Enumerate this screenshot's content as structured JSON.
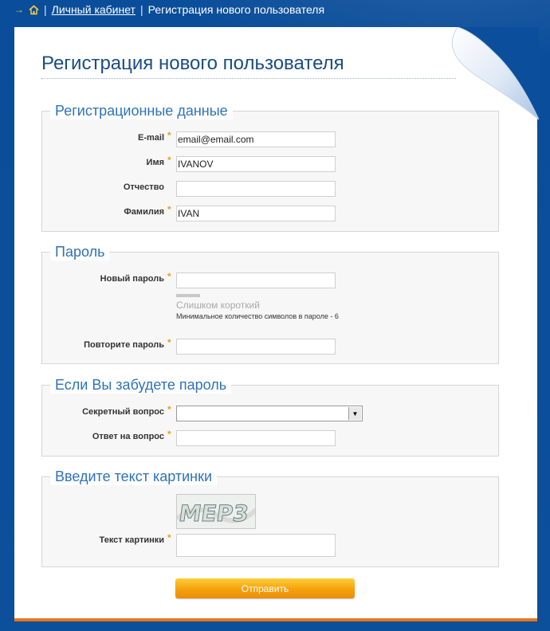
{
  "breadcrumb": {
    "home_icon": "home-icon",
    "separator": "|",
    "items": [
      {
        "label": "Личный кабинет",
        "link": true
      },
      {
        "label": "Регистрация нового пользователя",
        "link": false
      }
    ]
  },
  "page": {
    "title": "Регистрация нового пользователя"
  },
  "sections": {
    "registration": {
      "legend": "Регистрационные данные",
      "email": {
        "label": "E-mail",
        "required": "*",
        "value": "email@email.com"
      },
      "first_name": {
        "label": "Имя",
        "required": "*",
        "value": "IVANOV"
      },
      "patronymic": {
        "label": "Отчество",
        "value": ""
      },
      "last_name": {
        "label": "Фамилия",
        "required": "*",
        "value": "IVAN"
      }
    },
    "password": {
      "legend": "Пароль",
      "new": {
        "label": "Новый пароль",
        "required": "*",
        "value": ""
      },
      "strength": "Слишком короткий",
      "hint": "Минимальное количество символов в пароле - 6",
      "repeat": {
        "label": "Повторите пароль",
        "required": "*",
        "value": ""
      }
    },
    "recovery": {
      "legend": "Если Вы забудете пароль",
      "question": {
        "label": "Секретный вопрос",
        "required": "*",
        "value": ""
      },
      "answer": {
        "label": "Ответ на вопрос",
        "required": "*",
        "value": ""
      }
    },
    "captcha": {
      "legend": "Введите текст картинки",
      "image_text": "МЕР3",
      "input": {
        "label": "Текст картинки",
        "required": "*",
        "value": ""
      }
    }
  },
  "submit_label": "Отправить",
  "colors": {
    "background": "#0b4f9c",
    "title": "#1b4d82",
    "legend": "#2f72b8",
    "required": "#e6a21c",
    "button": "#f5a00c",
    "bottom_bar": "#e8781e"
  }
}
